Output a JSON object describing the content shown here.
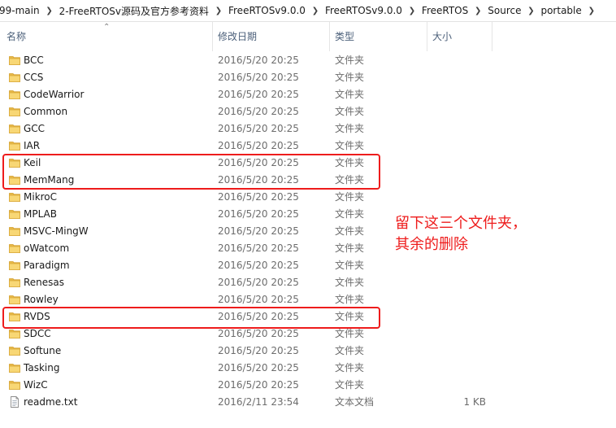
{
  "breadcrumb": [
    "99-main",
    "2-FreeRTOSv源码及官方参考资料",
    "FreeRTOSv9.0.0",
    "FreeRTOSv9.0.0",
    "FreeRTOS",
    "Source",
    "portable"
  ],
  "columns": {
    "name": "名称",
    "date": "修改日期",
    "type": "类型",
    "size": "大小"
  },
  "files": [
    {
      "name": "BCC",
      "date": "2016/5/20 20:25",
      "type": "文件夹",
      "size": "",
      "kind": "folder"
    },
    {
      "name": "CCS",
      "date": "2016/5/20 20:25",
      "type": "文件夹",
      "size": "",
      "kind": "folder"
    },
    {
      "name": "CodeWarrior",
      "date": "2016/5/20 20:25",
      "type": "文件夹",
      "size": "",
      "kind": "folder"
    },
    {
      "name": "Common",
      "date": "2016/5/20 20:25",
      "type": "文件夹",
      "size": "",
      "kind": "folder"
    },
    {
      "name": "GCC",
      "date": "2016/5/20 20:25",
      "type": "文件夹",
      "size": "",
      "kind": "folder"
    },
    {
      "name": "IAR",
      "date": "2016/5/20 20:25",
      "type": "文件夹",
      "size": "",
      "kind": "folder"
    },
    {
      "name": "Keil",
      "date": "2016/5/20 20:25",
      "type": "文件夹",
      "size": "",
      "kind": "folder"
    },
    {
      "name": "MemMang",
      "date": "2016/5/20 20:25",
      "type": "文件夹",
      "size": "",
      "kind": "folder"
    },
    {
      "name": "MikroC",
      "date": "2016/5/20 20:25",
      "type": "文件夹",
      "size": "",
      "kind": "folder"
    },
    {
      "name": "MPLAB",
      "date": "2016/5/20 20:25",
      "type": "文件夹",
      "size": "",
      "kind": "folder"
    },
    {
      "name": "MSVC-MingW",
      "date": "2016/5/20 20:25",
      "type": "文件夹",
      "size": "",
      "kind": "folder"
    },
    {
      "name": "oWatcom",
      "date": "2016/5/20 20:25",
      "type": "文件夹",
      "size": "",
      "kind": "folder"
    },
    {
      "name": "Paradigm",
      "date": "2016/5/20 20:25",
      "type": "文件夹",
      "size": "",
      "kind": "folder"
    },
    {
      "name": "Renesas",
      "date": "2016/5/20 20:25",
      "type": "文件夹",
      "size": "",
      "kind": "folder"
    },
    {
      "name": "Rowley",
      "date": "2016/5/20 20:25",
      "type": "文件夹",
      "size": "",
      "kind": "folder"
    },
    {
      "name": "RVDS",
      "date": "2016/5/20 20:25",
      "type": "文件夹",
      "size": "",
      "kind": "folder"
    },
    {
      "name": "SDCC",
      "date": "2016/5/20 20:25",
      "type": "文件夹",
      "size": "",
      "kind": "folder"
    },
    {
      "name": "Softune",
      "date": "2016/5/20 20:25",
      "type": "文件夹",
      "size": "",
      "kind": "folder"
    },
    {
      "name": "Tasking",
      "date": "2016/5/20 20:25",
      "type": "文件夹",
      "size": "",
      "kind": "folder"
    },
    {
      "name": "WizC",
      "date": "2016/5/20 20:25",
      "type": "文件夹",
      "size": "",
      "kind": "folder"
    },
    {
      "name": "readme.txt",
      "date": "2016/2/11 23:54",
      "type": "文本文档",
      "size": "1 KB",
      "kind": "text-file"
    }
  ],
  "annotation": {
    "line1": "留下这三个文件夹，",
    "line2": "其余的删除",
    "color": "#ee1c1c"
  },
  "icons": {
    "folder": "folder-icon",
    "text_file": "text-file-icon",
    "breadcrumb_separator": "chevron-right-icon",
    "sort": "sort-ascending-icon"
  },
  "colors": {
    "header_text": "#4c607a",
    "secondary_text": "#6d6d6d",
    "folder_yellow": "#f8d775",
    "highlight_red": "#ee1c1c"
  }
}
